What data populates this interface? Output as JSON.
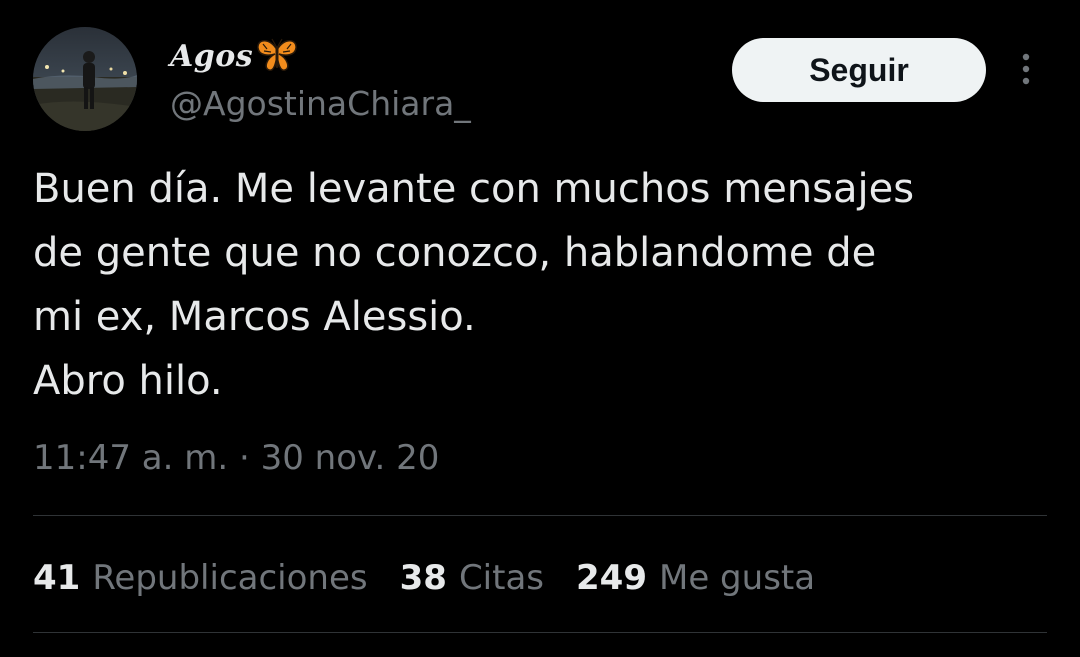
{
  "author": {
    "display_name": "Agos",
    "display_name_emoji": "butterfly-emoji",
    "handle": "@AgostinaChiara_"
  },
  "actions": {
    "follow_label": "Seguir",
    "more_icon": "more-vertical-icon"
  },
  "tweet": {
    "lines": [
      "Buen día. Me levante con muchos mensajes",
      "de gente que no conozco, hablandome de",
      "mi ex, Marcos Alessio.",
      "Abro hilo."
    ],
    "timestamp": "11:47 a. m. · 30 nov. 20"
  },
  "stats": [
    {
      "count": "41",
      "label": "Republicaciones"
    },
    {
      "count": "38",
      "label": "Citas"
    },
    {
      "count": "249",
      "label": "Me gusta"
    }
  ],
  "colors": {
    "background": "#000000",
    "text_primary": "#e7e9ea",
    "text_secondary": "#71767b",
    "divider": "#2f3336",
    "button_bg": "#eff3f4",
    "butterfly": "#f28c1c"
  }
}
